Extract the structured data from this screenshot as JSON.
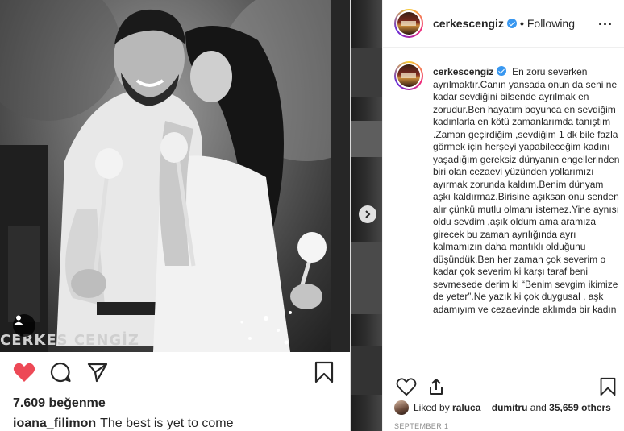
{
  "left_post": {
    "photo_text": "CERKES CENGİZ",
    "likes": "7.609 beğenme",
    "caption_user": "ioana_filimon",
    "caption_text": "The best is yet to come"
  },
  "header": {
    "username": "cerkescengiz",
    "separator": "•",
    "follow_status": "Following",
    "more_label": "..."
  },
  "comment": {
    "username": "cerkescengiz",
    "text": "En zoru severken ayrılmaktır.Canın yansada onun da seni ne kadar sevdiğini bilsende ayrılmak en zorudur.Ben hayatım boyunca en sevdiğim kadınlarla en kötü zamanlarımda tanıştım .Zaman geçirdiğim ,sevdiğim 1 dk bile fazla görmek için herşeyi yapabileceğim kadını yaşadığım gereksiz dünyanın engellerinden biri olan cezaevi yüzünden yollarımızı ayırmak zorunda kaldım.Benim dünyam aşkı kaldırmaz.Birisine aşıksan onu senden alır çünkü mutlu olmanı istemez.Yine aynısı oldu sevdim ,aşık oldum ama aramıza girecek bu zaman ayrılığında ayrı kalmamızın daha mantıklı olduğunu düşündük.Ben her zaman çok severim o kadar çok severim ki karşı taraf beni sevmesede derim ki “Benim sevgim ikimize de yeter”.Ne yazık ki çok duygusal , aşk adamıyım ve cezaevinde aklımda bir kadın"
  },
  "likes_right": {
    "prefix": "Liked by",
    "user": "raluca__dumitru",
    "middle": "and",
    "others": "35,659 others"
  },
  "date": "SEPTEMBER 1",
  "icons": {
    "left_like": "heart-filled-icon",
    "left_comment": "comment-icon",
    "left_share": "share-icon",
    "left_save": "bookmark-icon",
    "right_like": "heart-outline-icon",
    "right_share": "upload-icon",
    "right_save": "bookmark-icon",
    "next": "chevron-right-icon",
    "tag": "user-tag-icon"
  },
  "colors": {
    "like_red": "#ed4956",
    "verified_blue": "#3897f0",
    "muted": "#8e8e8e"
  }
}
